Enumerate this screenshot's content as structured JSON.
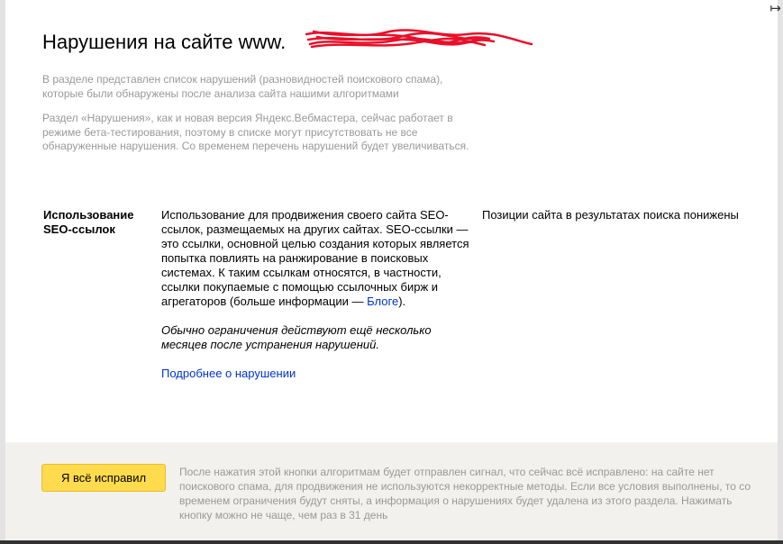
{
  "header": {
    "title": "Нарушения на сайте www.",
    "expand_icon": "↦"
  },
  "intro": {
    "paragraph1": "В разделе представлен список нарушений (разновидностей поискового спама), которые были обнаружены после анализа сайта нашими алгоритмами",
    "paragraph2": "Раздел «Нарушения», как и новая версия Яндекс.Вебмастера, сейчас работает в режиме бета-тестирования, поэтому в списке могут присутствовать не все обнаруженные нарушения. Со временем перечень нарушений будет увеличиваться."
  },
  "violation": {
    "name": "Использование SEO-ссылок",
    "description": "Использование для продвижения своего сайта SEO-ссылок, размещаемых на других сайтах. SEO-ссылки — это ссылки, основной целью создания которых является попытка повлиять на ранжирование в поисковых системах. К таким ссылкам относятся, в частности, ссылки покупаемые с помощью ссылочных бирж и агрегаторов (больше информации —",
    "blog_link": "Блоге",
    "description_end": ").",
    "note": "Обычно ограничения действуют ещё несколько месяцев после устранения нарушений.",
    "more_link": "Подробнее о нарушении",
    "effect": "Позиции сайта в результатах поиска понижены"
  },
  "footer": {
    "button_label": "Я всё исправил",
    "note": "После нажатия этой кнопки алгоритмам будет отправлен сигнал, что сейчас всё исправлено: на сайте нет поискового спама, для продвижения не используются некорректные методы. Если все условия выполнены, то со временем ограничения будут сняты, а информация о нарушениях будет удалена из этого раздела. Нажимать кнопку можно не чаще, чем раз в 31 день"
  },
  "colors": {
    "button_bg": "#ffdb4d",
    "link": "#0033cc",
    "muted_text": "#999999",
    "footer_bg": "#f2f1ee",
    "redaction": "#e8102a"
  }
}
